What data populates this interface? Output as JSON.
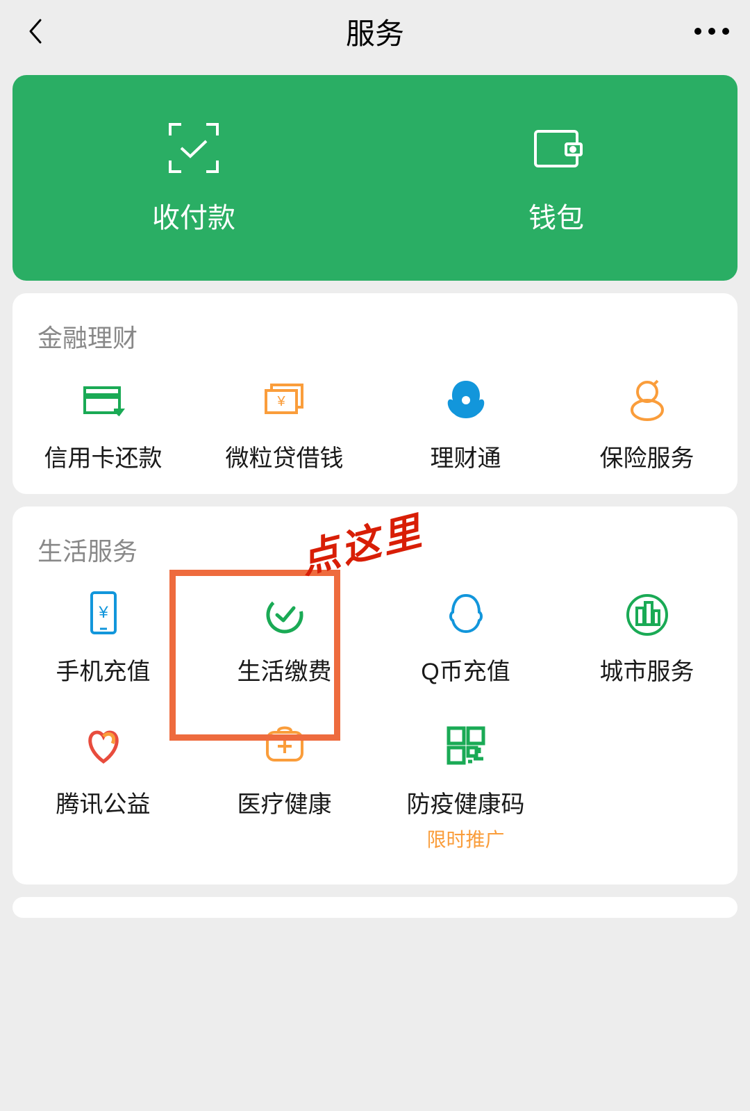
{
  "header": {
    "title": "服务"
  },
  "hero": {
    "pay": "收付款",
    "wallet": "钱包"
  },
  "sections": [
    {
      "title": "金融理财",
      "items": [
        {
          "label": "信用卡还款",
          "icon": "credit-card"
        },
        {
          "label": "微粒贷借钱",
          "icon": "loan"
        },
        {
          "label": "理财通",
          "icon": "invest"
        },
        {
          "label": "保险服务",
          "icon": "insurance"
        }
      ]
    },
    {
      "title": "生活服务",
      "items": [
        {
          "label": "手机充值",
          "icon": "phone-recharge"
        },
        {
          "label": "生活缴费",
          "icon": "life-pay"
        },
        {
          "label": "Q币充值",
          "icon": "qq-coin"
        },
        {
          "label": "城市服务",
          "icon": "city"
        },
        {
          "label": "腾讯公益",
          "icon": "charity"
        },
        {
          "label": "医疗健康",
          "icon": "medical"
        },
        {
          "label": "防疫健康码",
          "icon": "health-code",
          "sub": "限时推广"
        }
      ]
    }
  ],
  "annotation": "点这里"
}
